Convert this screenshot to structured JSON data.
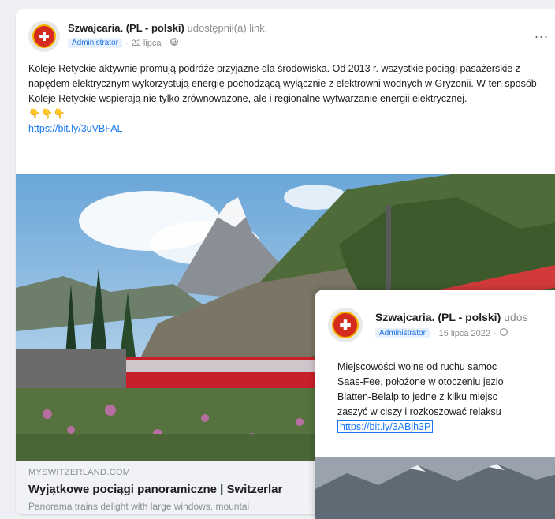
{
  "post1": {
    "author": "Szwajcaria. (PL - polski)",
    "action": "udostępnił(a) link.",
    "role": "Administrator",
    "date": "22 lipca",
    "text": "Koleje Retyckie aktywnie promują podróże przyjazne dla środowiska. Od 2013 r. wszystkie pociągi pasażerskie z napędem elektrycznym wykorzystują energię pochodzącą wyłącznie z elektrowni wodnych w Gryzonii. W ten sposób Koleje Retyckie wspierają nie tylko zrównoważone, ale i regionalne wytwarzanie energii elektrycznej.",
    "emojis": "👇👇👇",
    "link": "https://bit.ly/3uVBFAL",
    "more": "...",
    "preview": {
      "domain": "MYSWITZERLAND.COM",
      "title": "Wyjątkowe pociągi panoramiczne | Switzerlar",
      "description": "Panorama trains delight with large windows, mountai"
    }
  },
  "post2": {
    "author": "Szwajcaria. (PL - polski)",
    "action": "udos",
    "role": "Administrator",
    "date": "15 lipca 2022",
    "lines": [
      "Miejscowości wolne od ruchu samoc",
      "Saas-Fee, położone w otoczeniu jezio",
      "Blatten-Belalp to jedne z kilku miejsc",
      "zaszyć w ciszy i rozkoszować relaksu"
    ],
    "link": "https://bit.ly/3ABjh3P"
  },
  "colors": {
    "link": "#1877f2",
    "accent": "#d52b1e"
  }
}
